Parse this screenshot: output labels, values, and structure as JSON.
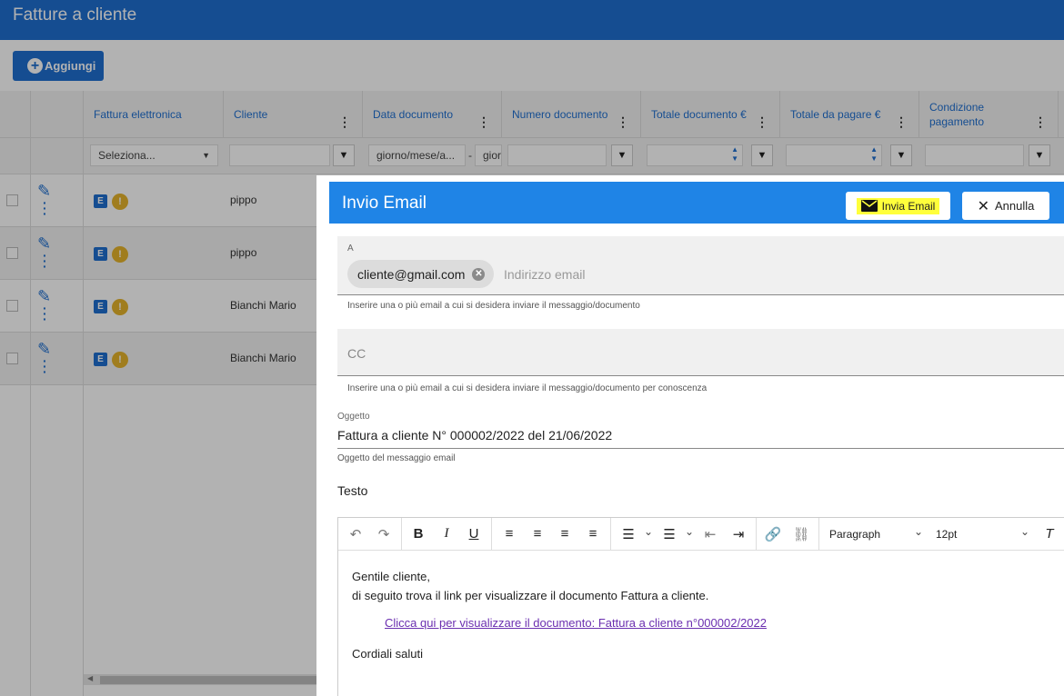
{
  "page": {
    "title": "Fatture a cliente",
    "add_label": "Aggiungi"
  },
  "grid": {
    "columns": [
      "Fattura elettronica",
      "Cliente",
      "Data documento",
      "Numero documento",
      "Totale documento €",
      "Totale da pagare €",
      "Condizione pagamento"
    ],
    "filters": {
      "select_placeholder": "Seleziona...",
      "date_from": "giorno/mese/a...",
      "date_sep": "-",
      "date_to": "gior"
    },
    "rows": [
      {
        "e_badge": "E",
        "warn": "!",
        "cliente": "pippo"
      },
      {
        "e_badge": "E",
        "warn": "!",
        "cliente": "pippo"
      },
      {
        "e_badge": "E",
        "warn": "!",
        "cliente": "Bianchi Mario"
      },
      {
        "e_badge": "E",
        "warn": "!",
        "cliente": "Bianchi Mario"
      }
    ]
  },
  "dialog": {
    "title": "Invio Email",
    "send_label": "Invia Email",
    "cancel_label": "Annulla",
    "to": {
      "label": "A",
      "chip": "cliente@gmail.com",
      "placeholder": "Indirizzo email",
      "hint": "Inserire una o più email a cui si desidera inviare il messaggio/documento"
    },
    "cc": {
      "placeholder": "CC",
      "hint": "Inserire una o più email a cui si desidera inviare il messaggio/documento per conoscenza"
    },
    "subject": {
      "label": "Oggetto",
      "value": "Fattura a cliente N° 000002/2022 del 21/06/2022",
      "hint": "Oggetto del messaggio email"
    },
    "body_label": "Testo",
    "editor": {
      "block_format": "Paragraph",
      "font_size": "12pt",
      "line1": "Gentile cliente,",
      "line2": "di seguito trova il link per visualizzare il documento Fattura a cliente.",
      "link": "Clicca qui per visualizzare il documento: Fattura a cliente n°000002/2022",
      "closing": "Cordiali saluti"
    }
  },
  "colors": {
    "primary": "#1f6fd0",
    "dialog_header": "#1f84e6",
    "highlight": "#ffff3b",
    "warn": "#e6b42b"
  }
}
